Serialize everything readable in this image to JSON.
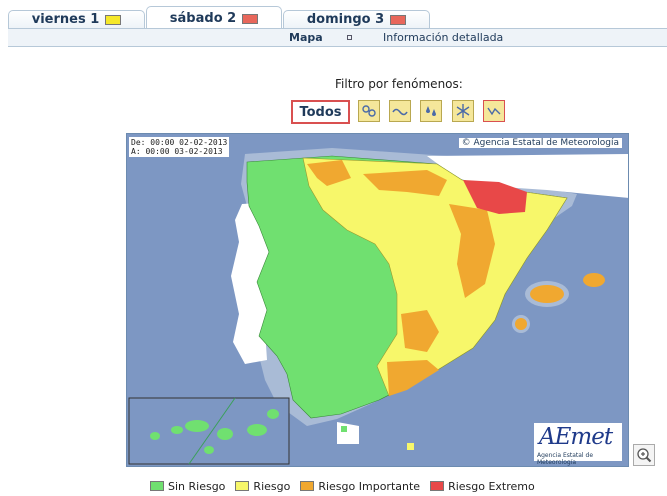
{
  "tabs": [
    {
      "label": "viernes 1",
      "color": "#f5e82a"
    },
    {
      "label": "sábado 2",
      "color": "#e8675b"
    },
    {
      "label": "domingo 3",
      "color": "#e8675b"
    }
  ],
  "subnav": {
    "map_label": "Mapa",
    "info_label": "Información detallada"
  },
  "filter": {
    "label": "Filtro por fenómenos:",
    "all_label": "Todos",
    "phenomena_icons": [
      "wind-icon",
      "coastal-icon",
      "rain-icon",
      "snow-icon",
      "temperature-icon"
    ]
  },
  "map": {
    "date_from": "De: 00:00 02-02-2013",
    "date_to": "A:  00:00 03-02-2013",
    "copyright": "Agencia Estatal de Meteorología",
    "logo_text": "AEmet",
    "logo_sub": "Agencia Estatal de Meteorología"
  },
  "legend": [
    {
      "label": "Sin Riesgo",
      "color": "#70e070"
    },
    {
      "label": "Riesgo",
      "color": "#f7f76a"
    },
    {
      "label": "Riesgo Importante",
      "color": "#f0a830"
    },
    {
      "label": "Riesgo Extremo",
      "color": "#e84848"
    }
  ]
}
